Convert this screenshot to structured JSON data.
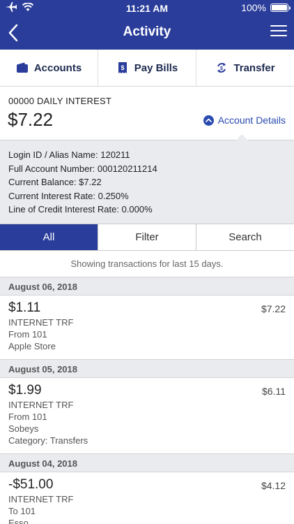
{
  "status_bar": {
    "time": "11:21 AM",
    "battery": "100%"
  },
  "nav": {
    "title": "Activity"
  },
  "quick_actions": [
    {
      "label": "Accounts",
      "icon": "wallet-icon"
    },
    {
      "label": "Pay Bills",
      "icon": "bill-icon"
    },
    {
      "label": "Transfer",
      "icon": "transfer-icon"
    }
  ],
  "account": {
    "name": "00000 DAILY INTEREST",
    "balance": "$7.22",
    "details_link": "Account Details"
  },
  "details": [
    "Login ID / Alias Name: 120211",
    "Full Account Number: 000120211214",
    "Current Balance: $7.22",
    "Current Interest Rate: 0.250%",
    "Line of Credit Interest Rate: 0.000%"
  ],
  "tabs": {
    "all": "All",
    "filter": "Filter",
    "search": "Search"
  },
  "showing": "Showing transactions for last 15 days.",
  "groups": [
    {
      "date": "August 06, 2018",
      "transactions": [
        {
          "amount": "$1.11",
          "running": "$7.22",
          "lines": [
            "INTERNET TRF",
            "From 101",
            "Apple Store"
          ]
        }
      ]
    },
    {
      "date": "August 05, 2018",
      "transactions": [
        {
          "amount": "$1.99",
          "running": "$6.11",
          "lines": [
            "INTERNET TRF",
            "From 101",
            "Sobeys",
            "Category: Transfers"
          ]
        }
      ]
    },
    {
      "date": "August 04, 2018",
      "transactions": [
        {
          "amount": "-$51.00",
          "running": "$4.12",
          "lines": [
            "INTERNET TRF",
            "To 101",
            "Esso"
          ]
        }
      ]
    }
  ],
  "colors": {
    "brand": "#2a3d9a",
    "link": "#2a4bb0",
    "panel": "#e9ebee"
  }
}
